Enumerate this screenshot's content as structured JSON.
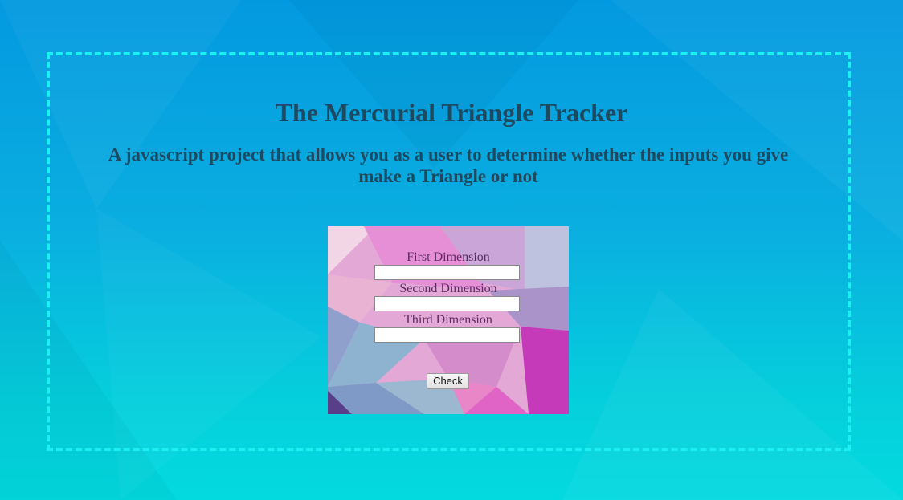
{
  "page": {
    "title": "The Mercurial Triangle Tracker",
    "subtitle": "A javascript project that allows you as a user to determine whether the inputs you give make a Triangle or not"
  },
  "form": {
    "fields": [
      {
        "label": "First Dimension",
        "value": ""
      },
      {
        "label": "Second Dimension",
        "value": ""
      },
      {
        "label": "Third Dimension",
        "value": ""
      }
    ],
    "submit_label": "Check"
  },
  "colors": {
    "background_top": "#0399e0",
    "background_bottom": "#03dadf",
    "frame_border": "#1cf0f3",
    "heading_text": "#1d4a60",
    "label_text": "#5b2d63",
    "card_pink": "#e68fd6",
    "card_magenta": "#c43ab8",
    "card_lavender": "#9fa6d3"
  }
}
